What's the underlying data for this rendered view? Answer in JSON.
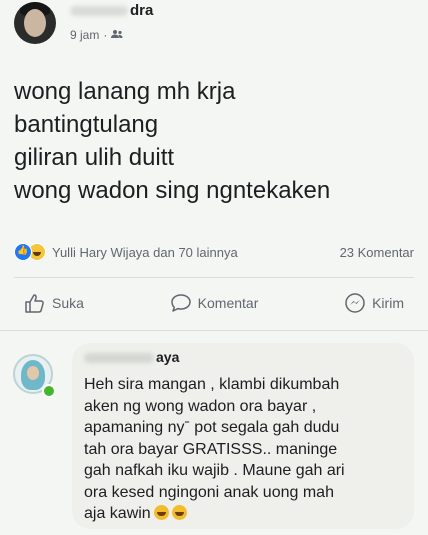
{
  "post": {
    "author_visible": "dra",
    "time": "9 jam",
    "audience_icon": "friends-icon",
    "lines": [
      "wong lanang mh krja",
      "bantingtulang",
      "giliran ulih duitt",
      "wong wadon sing ngntekaken"
    ],
    "reactions_text": "Yulli Hary Wijaya dan 70 lainnya",
    "comments_count": "23 Komentar"
  },
  "actions": {
    "like": "Suka",
    "comment": "Komentar",
    "share": "Kirim"
  },
  "comment": {
    "author_visible": "aya",
    "lines": [
      "Heh sira mangan , klambi dikumbah",
      "aken ng wong wadon ora bayar ,",
      "apamaning nyˉ pot segala gah dudu",
      "tah ora bayar GRATISSS.. maninge",
      "gah nafkah iku wajib . Maune gah ari",
      "ora kesed ngingoni anak uong mah",
      "aja kawin"
    ]
  },
  "colors": {
    "background": "#f4f6f3",
    "like_blue": "#2078f4",
    "haha_yellow": "#f7c53c",
    "online_green": "#42b72a"
  }
}
